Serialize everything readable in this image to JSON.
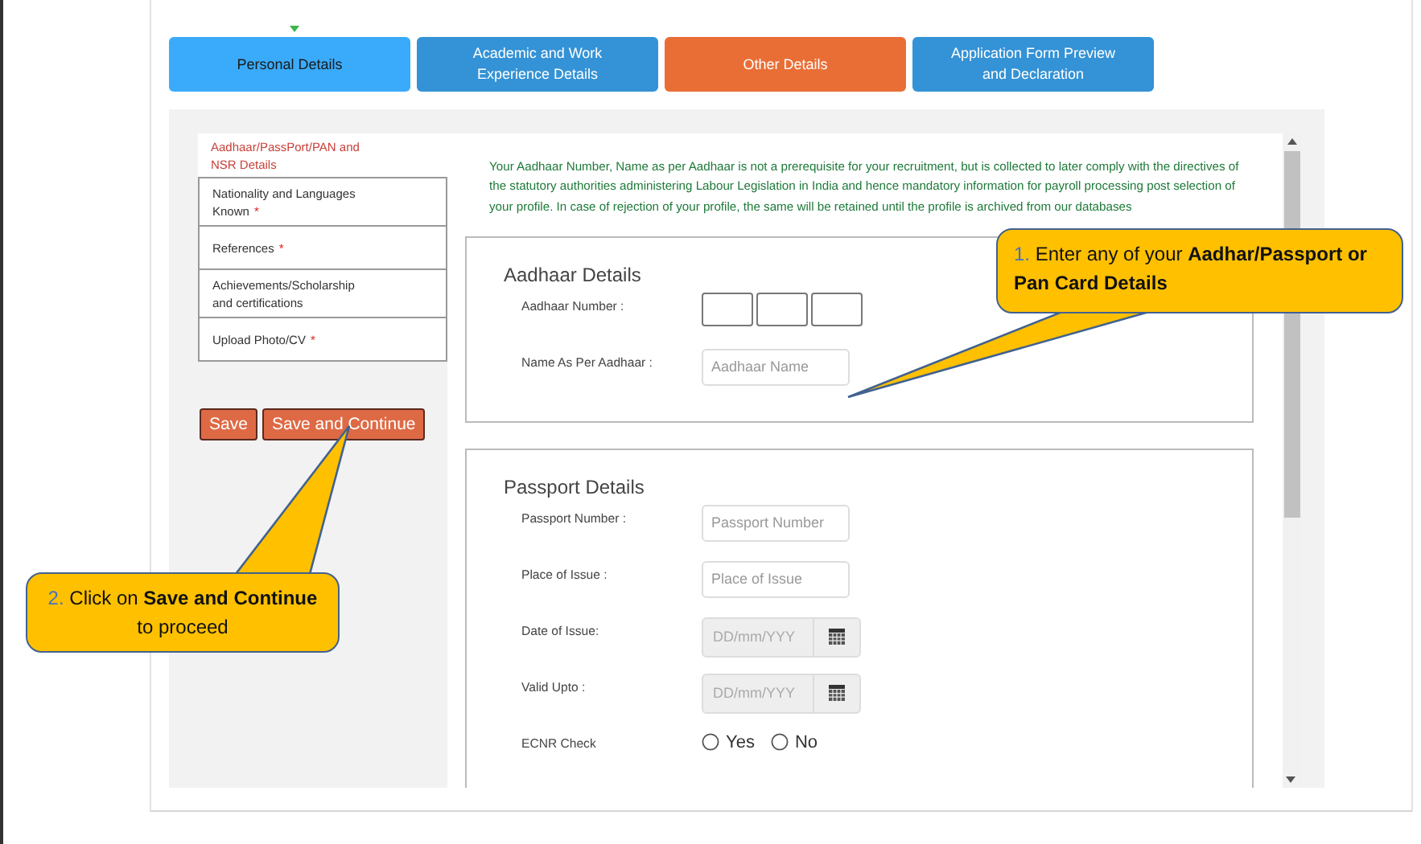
{
  "tabs": [
    {
      "label": "Personal Details",
      "selected": false,
      "completed": true
    },
    {
      "label": "Academic and Work Experience Details",
      "selected": false,
      "completed": false
    },
    {
      "label": "Other Details",
      "selected": true,
      "completed": false
    },
    {
      "label": "Application Form Preview and Declaration",
      "selected": false,
      "completed": false
    }
  ],
  "sidebar": {
    "items": [
      {
        "label": "Aadhaar/PassPort/PAN and NSR Details",
        "selected": true
      },
      {
        "label": "Nationality and Languages Known",
        "required_mark": "*",
        "selected": false
      },
      {
        "label": "References",
        "required_mark": "*",
        "selected": false
      },
      {
        "label": "Achievements/Scholarship and certifications",
        "selected": false
      },
      {
        "label": "Upload Photo/CV",
        "required_mark": "*",
        "selected": false
      }
    ],
    "buttons": [
      "Save",
      "Save and Continue"
    ]
  },
  "notice": "Your Aadhaar Number, Name as per Aadhaar is not a prerequisite for your recruitment, but is collected to later comply with the directives of the statutory authorities administering Labour Legislation in India and hence mandatory information for payroll processing post selection of your profile. In case of rejection of your profile, the same will be retained until the profile is archived from our databases",
  "sections": [
    {
      "title": "Aadhaar Details",
      "fields": [
        {
          "label": "Aadhaar Number :",
          "kind": "split"
        },
        {
          "label": "Name As Per Aadhaar :",
          "kind": "text",
          "placeholder": "Aadhaar Name"
        }
      ]
    },
    {
      "title": "Passport Details",
      "fields": [
        {
          "label": "Passport Number :",
          "kind": "text",
          "placeholder": "Passport Number"
        },
        {
          "label": "Place of Issue :",
          "kind": "text",
          "placeholder": "Place of Issue"
        },
        {
          "label": "Date of Issue:",
          "kind": "date",
          "placeholder": "DD/mm/YYY"
        },
        {
          "label": "Valid Upto :",
          "kind": "date",
          "placeholder": "DD/mm/YYY"
        },
        {
          "label": "ECNR Check",
          "kind": "radio",
          "options": [
            {
              "label": "Yes",
              "selected": false
            },
            {
              "label": "No",
              "selected": false
            }
          ]
        }
      ]
    }
  ],
  "callouts": [
    {
      "number": "1.",
      "text": "Enter any of your **Aadhar/Passport or Pan Card Details**"
    },
    {
      "number": "2.",
      "text": "Click on **Save and Continue** to proceed"
    }
  ]
}
